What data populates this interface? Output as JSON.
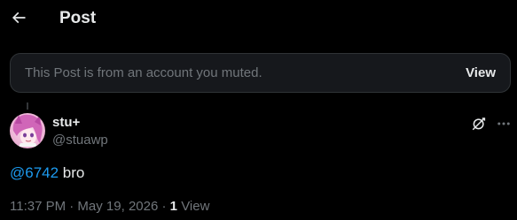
{
  "header": {
    "back_icon": "arrow-left-icon",
    "title": "Post"
  },
  "muted_banner": {
    "text": "This Post is from an account you muted.",
    "view_label": "View"
  },
  "post": {
    "author": {
      "display_name": "stu+",
      "handle": "@stuawp",
      "avatar": "avatar-image"
    },
    "actions": {
      "grok_icon": "grok-icon",
      "more_icon": "more-horizontal-icon"
    },
    "mention": "@6742",
    "body": " bro",
    "timestamp": "11:37 PM · May 19, 2026",
    "separator": " · ",
    "view_count": "1",
    "view_label": "View"
  },
  "colors": {
    "background": "#000000",
    "banner_background": "#16181c",
    "primary_text": "#e7e9ea",
    "secondary_text": "#71767b",
    "accent": "#1d9bf0"
  }
}
